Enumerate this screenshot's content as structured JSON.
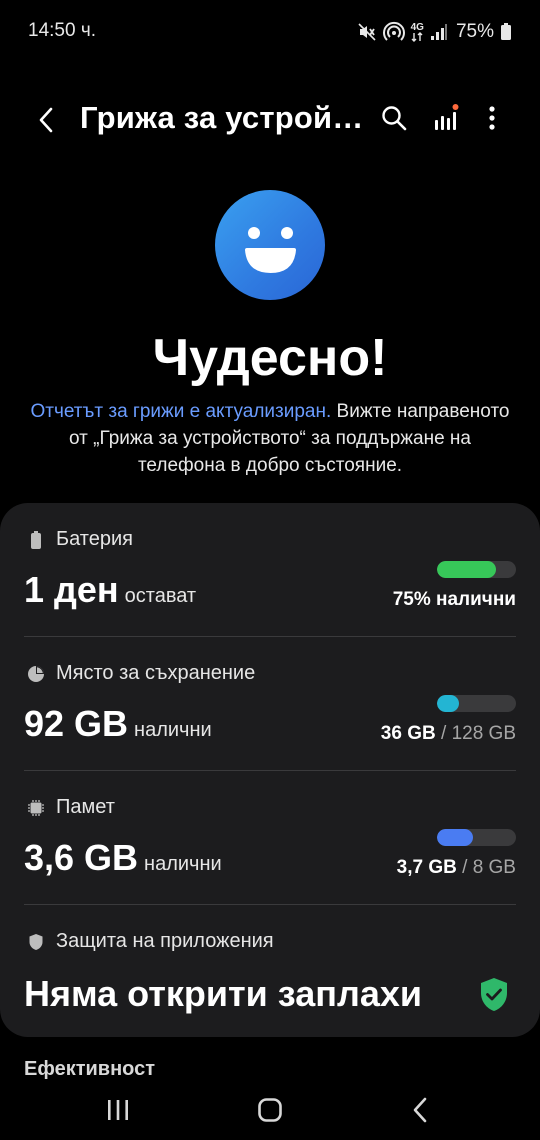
{
  "status_bar": {
    "time": "14:50 ч.",
    "network": "4G",
    "battery_percent": "75%"
  },
  "app_bar": {
    "title": "Грижа за устройството",
    "icons": [
      "back-icon",
      "search-icon",
      "chart-icon",
      "more-icon"
    ]
  },
  "summary": {
    "headline": "Чудесно!",
    "link_text": "Отчетът за грижи е актуализиран.",
    "description": " Вижте направеното от „Грижа за устройството“ за поддържане на телефона в добро състояние.",
    "link_color": "#6a9cff"
  },
  "battery": {
    "title": "Батерия",
    "value": "1 ден",
    "unit": "остават",
    "right_value": "75% налични",
    "level": 0.75,
    "color": "#37c759"
  },
  "storage": {
    "title": "Място за съхранение",
    "value": "92 GB",
    "unit": "налични",
    "used": "36 GB",
    "separator": " / ",
    "total": "128 GB",
    "level": 0.28,
    "color": "#23b5d3"
  },
  "memory": {
    "title": "Памет",
    "value": "3,6 GB",
    "unit": "налични",
    "used": "3,7 GB",
    "separator": " / ",
    "total": "8 GB",
    "level": 0.46,
    "color": "#4a7cf2"
  },
  "app_protection": {
    "title": "Защита на приложения",
    "status": "Няма открити заплахи",
    "status_color": "#2fb86a"
  },
  "next_section": {
    "title": "Ефективност"
  },
  "nav_bar": {
    "icons": [
      "recents-icon",
      "home-icon",
      "back-nav-icon"
    ]
  }
}
